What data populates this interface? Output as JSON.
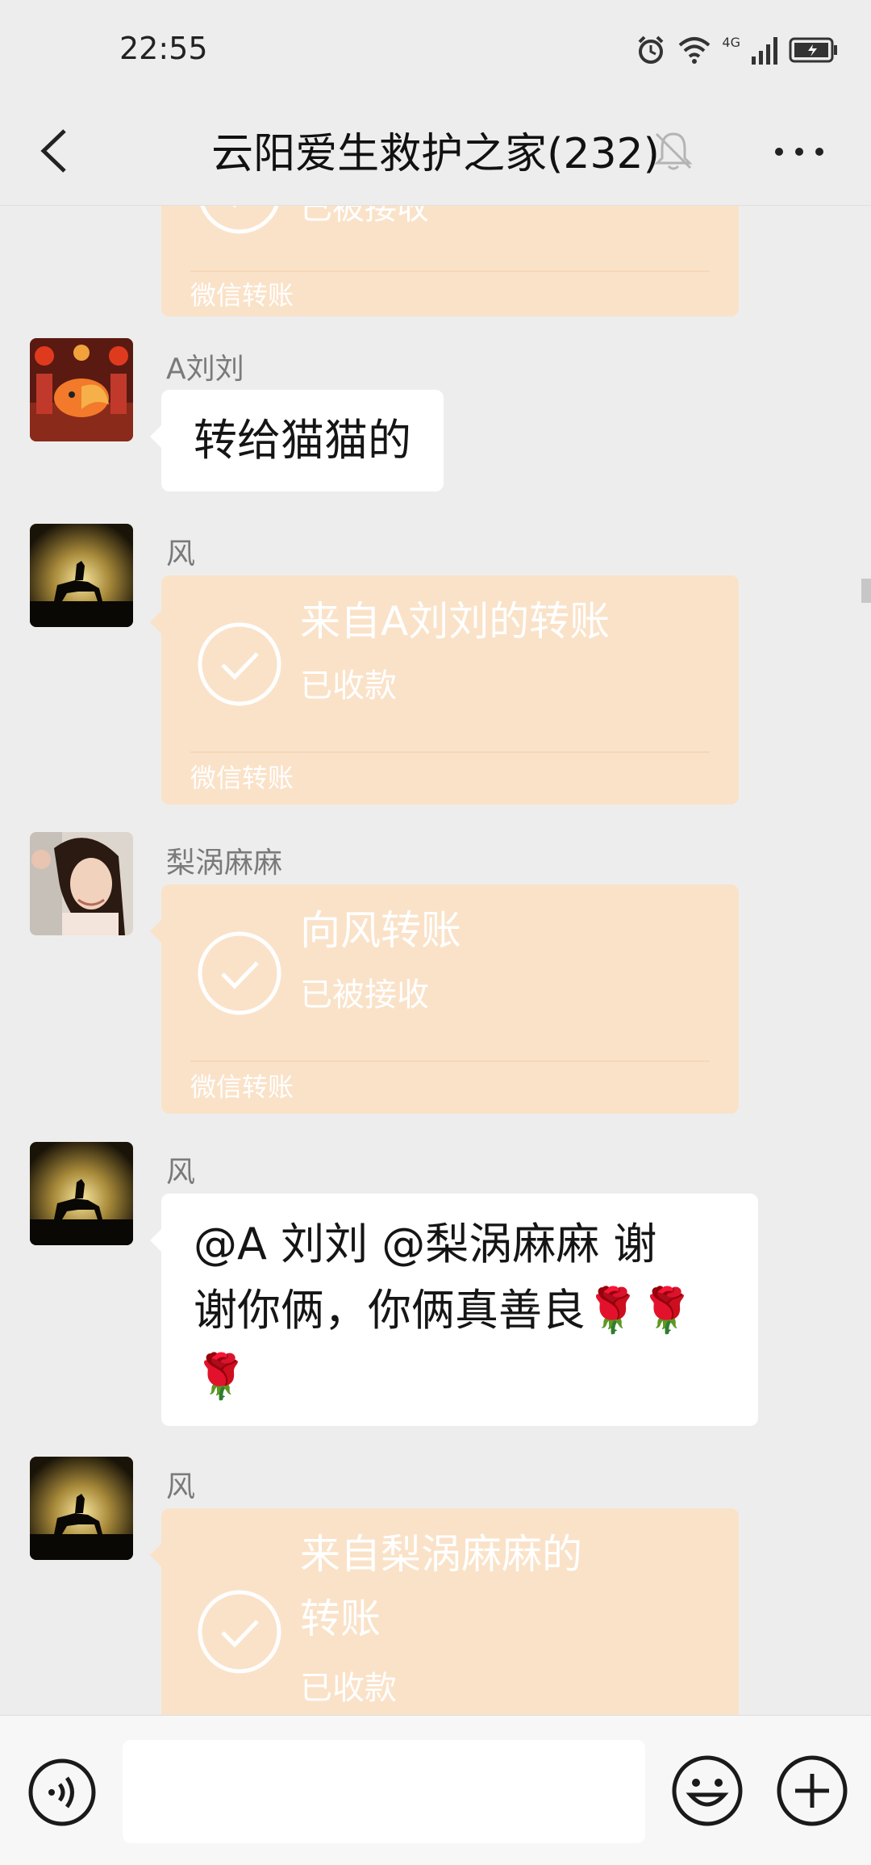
{
  "status_bar": {
    "time": "22:55",
    "network": "4G"
  },
  "header": {
    "title": "云阳爱生救护之家(232)",
    "back_icon": "chevron-left-icon",
    "mute_icon": "bell-off-icon",
    "more_icon": "more-dots-icon"
  },
  "messages": [
    {
      "type": "transfer",
      "title": "",
      "status": "已被接收",
      "footer": "微信转账",
      "partial": true
    },
    {
      "type": "text",
      "sender": "A刘刘",
      "text": "转给猫猫的"
    },
    {
      "type": "transfer",
      "sender": "风",
      "title": "来自A刘刘的转账",
      "status": "已收款",
      "footer": "微信转账"
    },
    {
      "type": "transfer",
      "sender": "梨涡麻麻",
      "title": "向风转账",
      "status": "已被接收",
      "footer": "微信转账"
    },
    {
      "type": "text",
      "sender": "风",
      "line1": "@A 刘刘  @梨涡麻麻  谢",
      "line2": "谢你俩，你俩真善良🌹🌹",
      "line3": "🌹"
    },
    {
      "type": "transfer",
      "sender": "风",
      "title_line1": "来自梨涡麻麻的",
      "title_line2": "转账",
      "status": "已收款"
    }
  ],
  "input_bar": {
    "voice_icon": "voice-icon",
    "emoji_icon": "emoji-icon",
    "plus_icon": "plus-icon",
    "value": ""
  },
  "colors": {
    "background": "#ededed",
    "transfer_bubble": "#fae2c8",
    "bubble_white": "#ffffff"
  }
}
